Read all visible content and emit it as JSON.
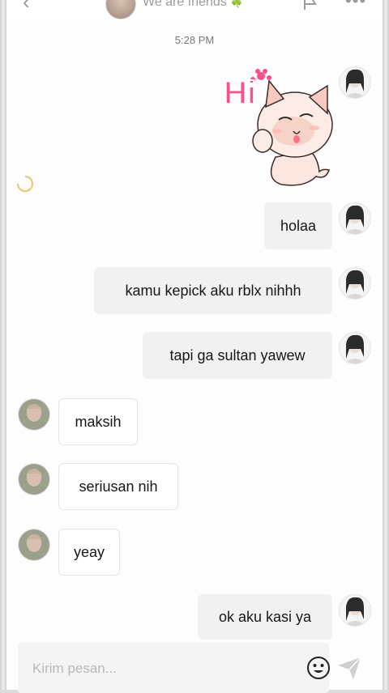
{
  "header": {
    "title": "We are friends",
    "title_emoji": "🍀"
  },
  "chat": {
    "timestamp": "5:28 PM",
    "messages": [
      {
        "side": "out",
        "text": "holaa"
      },
      {
        "side": "out",
        "text": "kamu kepick aku rblx nihhh"
      },
      {
        "side": "out",
        "text": "tapi ga sultan yawew"
      },
      {
        "side": "in",
        "text": "maksih"
      },
      {
        "side": "in",
        "text": "seriusan nih"
      },
      {
        "side": "in",
        "text": "yeay"
      },
      {
        "side": "out",
        "text": "ok aku kasi ya"
      }
    ],
    "sticker_text": "Hi"
  },
  "composer": {
    "placeholder": "Kirim pesan..."
  },
  "icons": {
    "back": "chevron-left-icon",
    "flag": "flag-icon",
    "more": "more-icon",
    "emoji": "emoji-icon",
    "send": "send-icon"
  },
  "colors": {
    "bubble_out": "#f1f1f1",
    "bubble_in": "#ffffff",
    "sticker_pink": "#ff4f8a"
  }
}
